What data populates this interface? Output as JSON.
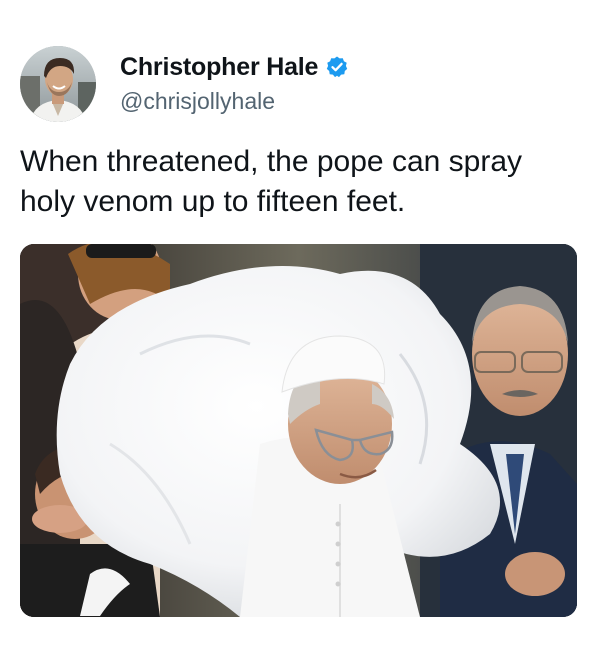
{
  "tweet": {
    "author": {
      "name": "Christopher Hale",
      "handle": "@chrisjollyhale",
      "verified": true,
      "verified_color": "#1d9bf0"
    },
    "text": "When threatened, the pope can spray holy venom up to fifteen feet.",
    "media": {
      "type": "photo"
    }
  },
  "colors": {
    "name_text": "#0f1419",
    "handle_text": "#536471",
    "background": "#ffffff"
  }
}
